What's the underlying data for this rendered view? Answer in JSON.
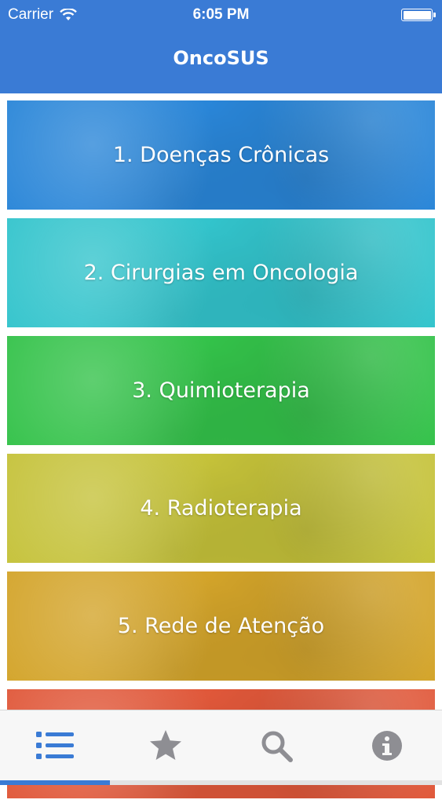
{
  "status_bar": {
    "carrier": "Carrier",
    "time": "6:05 PM"
  },
  "header": {
    "title": "OncoSUS"
  },
  "accent_color": "#3a7bd5",
  "items": [
    {
      "label": "1. Doenças Crônicas",
      "color": "#2a86d8"
    },
    {
      "label": "2. Cirurgias em Oncologia",
      "color": "#33c4cc"
    },
    {
      "label": "3. Quimioterapia",
      "color": "#34c24a"
    },
    {
      "label": "4. Radioterapia",
      "color": "#c5c23a"
    },
    {
      "label": "5. Rede de Atenção",
      "color": "#d3a42a"
    },
    {
      "label": "",
      "color": "#e0583a"
    }
  ],
  "tabbar": {
    "tabs": [
      {
        "icon": "list-icon",
        "selected": true
      },
      {
        "icon": "star-icon",
        "selected": false
      },
      {
        "icon": "search-icon",
        "selected": false
      },
      {
        "icon": "info-icon",
        "selected": false
      }
    ]
  }
}
